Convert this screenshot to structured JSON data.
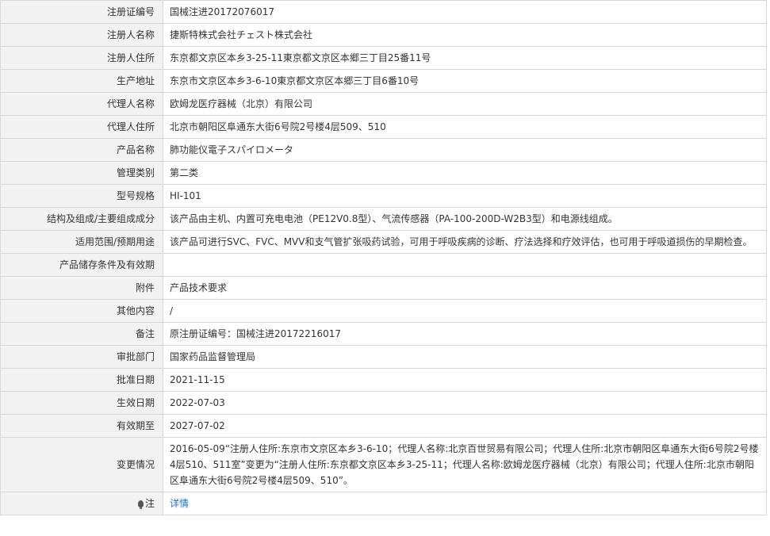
{
  "rows": [
    {
      "label": "注册证编号",
      "value": "国械注进20172076017"
    },
    {
      "label": "注册人名称",
      "value": "捷斯特株式会社チェスト株式会社"
    },
    {
      "label": "注册人住所",
      "value": "东京都文京区本乡3-25-11東京都文京区本郷三丁目25番11号"
    },
    {
      "label": "生产地址",
      "value": "东京市文京区本乡3-6-10東京都文京区本郷三丁目6番10号"
    },
    {
      "label": "代理人名称",
      "value": "欧姆龙医疗器械（北京）有限公司"
    },
    {
      "label": "代理人住所",
      "value": "北京市朝阳区阜通东大街6号院2号楼4层509、510"
    },
    {
      "label": "产品名称",
      "value": "肺功能仪電子スパイロメータ"
    },
    {
      "label": "管理类别",
      "value": "第二类"
    },
    {
      "label": "型号规格",
      "value": "HI-101"
    },
    {
      "label": "结构及组成/主要组成成分",
      "value": "该产品由主机、内置可充电电池（PE12V0.8型）、气流传感器（PA-100-200D-W2B3型）和电源线组成。"
    },
    {
      "label": "适用范围/预期用途",
      "value": "该产品可进行SVC、FVC、MVV和支气管扩张吸药试验，可用于呼吸疾病的诊断、疗法选择和疗效评估，也可用于呼吸道损伤的早期检查。"
    },
    {
      "label": "产品储存条件及有效期",
      "value": ""
    },
    {
      "label": "附件",
      "value": "产品技术要求"
    },
    {
      "label": "其他内容",
      "value": "/"
    },
    {
      "label": "备注",
      "value": "原注册证编号：国械注进20172216017"
    },
    {
      "label": "审批部门",
      "value": "国家药品监督管理局"
    },
    {
      "label": "批准日期",
      "value": "2021-11-15"
    },
    {
      "label": "生效日期",
      "value": "2022-07-03"
    },
    {
      "label": "有效期至",
      "value": "2027-07-02"
    },
    {
      "label": "变更情况",
      "value": "2016-05-09“注册人住所:东京市文京区本乡3-6-10；代理人名称:北京百世贸易有限公司；代理人住所:北京市朝阳区阜通东大街6号院2号楼4层510、511室”变更为“注册人住所:东京都文京区本乡3-25-11；代理人名称:欧姆龙医疗器械（北京）有限公司；代理人住所:北京市朝阳区阜通东大街6号院2号楼4层509、510”。"
    }
  ],
  "note": {
    "icon": "lightbulb-icon",
    "label": "注",
    "link_text": "详情"
  },
  "colors": {
    "label_bg": "#f2f2f2",
    "border": "#d8d8d8",
    "text": "#333333",
    "link": "#1a6fc9"
  }
}
